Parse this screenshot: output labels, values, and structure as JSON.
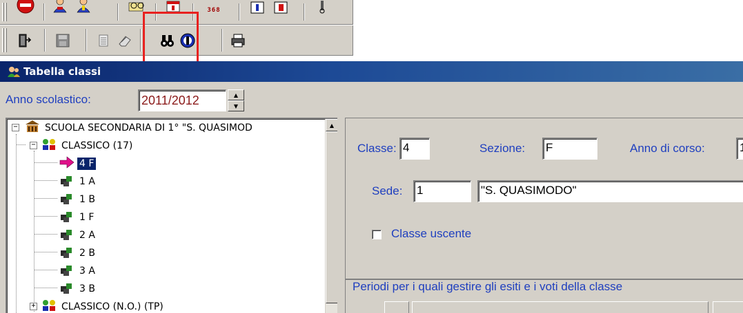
{
  "window": {
    "title": "Tabella classi"
  },
  "toolbar_top": {
    "buttons": [
      {
        "name": "stop-icon"
      },
      {
        "name": "users-icon"
      },
      {
        "name": "user-icon"
      },
      {
        "name": "edit-glasses-icon"
      },
      {
        "name": "calendar-icon"
      },
      {
        "name": "counter-icon",
        "text": "368"
      },
      {
        "name": "info-icon"
      },
      {
        "name": "flag-icon"
      },
      {
        "name": "wrench-icon"
      }
    ]
  },
  "toolbar_bottom": {
    "buttons": [
      {
        "name": "exit-door-icon"
      },
      {
        "name": "save-disk-icon"
      },
      {
        "name": "list-icon"
      },
      {
        "name": "eraser-icon"
      },
      {
        "name": "find-binoculars-icon"
      },
      {
        "name": "cancel-circle-icon"
      },
      {
        "name": "printer-icon"
      }
    ]
  },
  "anno": {
    "label": "Anno scolastico:",
    "value": "2011/2012"
  },
  "tree": {
    "root": "SCUOLA SECONDARIA DI 1° \"S. QUASIMOD",
    "group": "CLASSICO (17)",
    "items": [
      "4 F",
      "1 A",
      "1 B",
      "1 F",
      "2 A",
      "2 B",
      "3 A",
      "3 B"
    ],
    "next_group": "CLASSICO (N.O.) (TP)"
  },
  "detail": {
    "classe_label": "Classe:",
    "classe_value": "4",
    "sezione_label": "Sezione:",
    "sezione_value": "F",
    "anno_corso_label": "Anno di corso:",
    "anno_corso_value": "1",
    "sede_label": "Sede:",
    "sede_value": "1",
    "sede_name": "\"S. QUASIMODO\"",
    "uscente_label": "Classe uscente"
  },
  "periods": {
    "label": "Periodi per i quali gestire gli esiti e i voti della classe"
  },
  "colors": {
    "titlebar": "#0a246a",
    "selection": "#0a246a",
    "label_blue": "#1f3fbf",
    "highlight": "#e8211f"
  }
}
